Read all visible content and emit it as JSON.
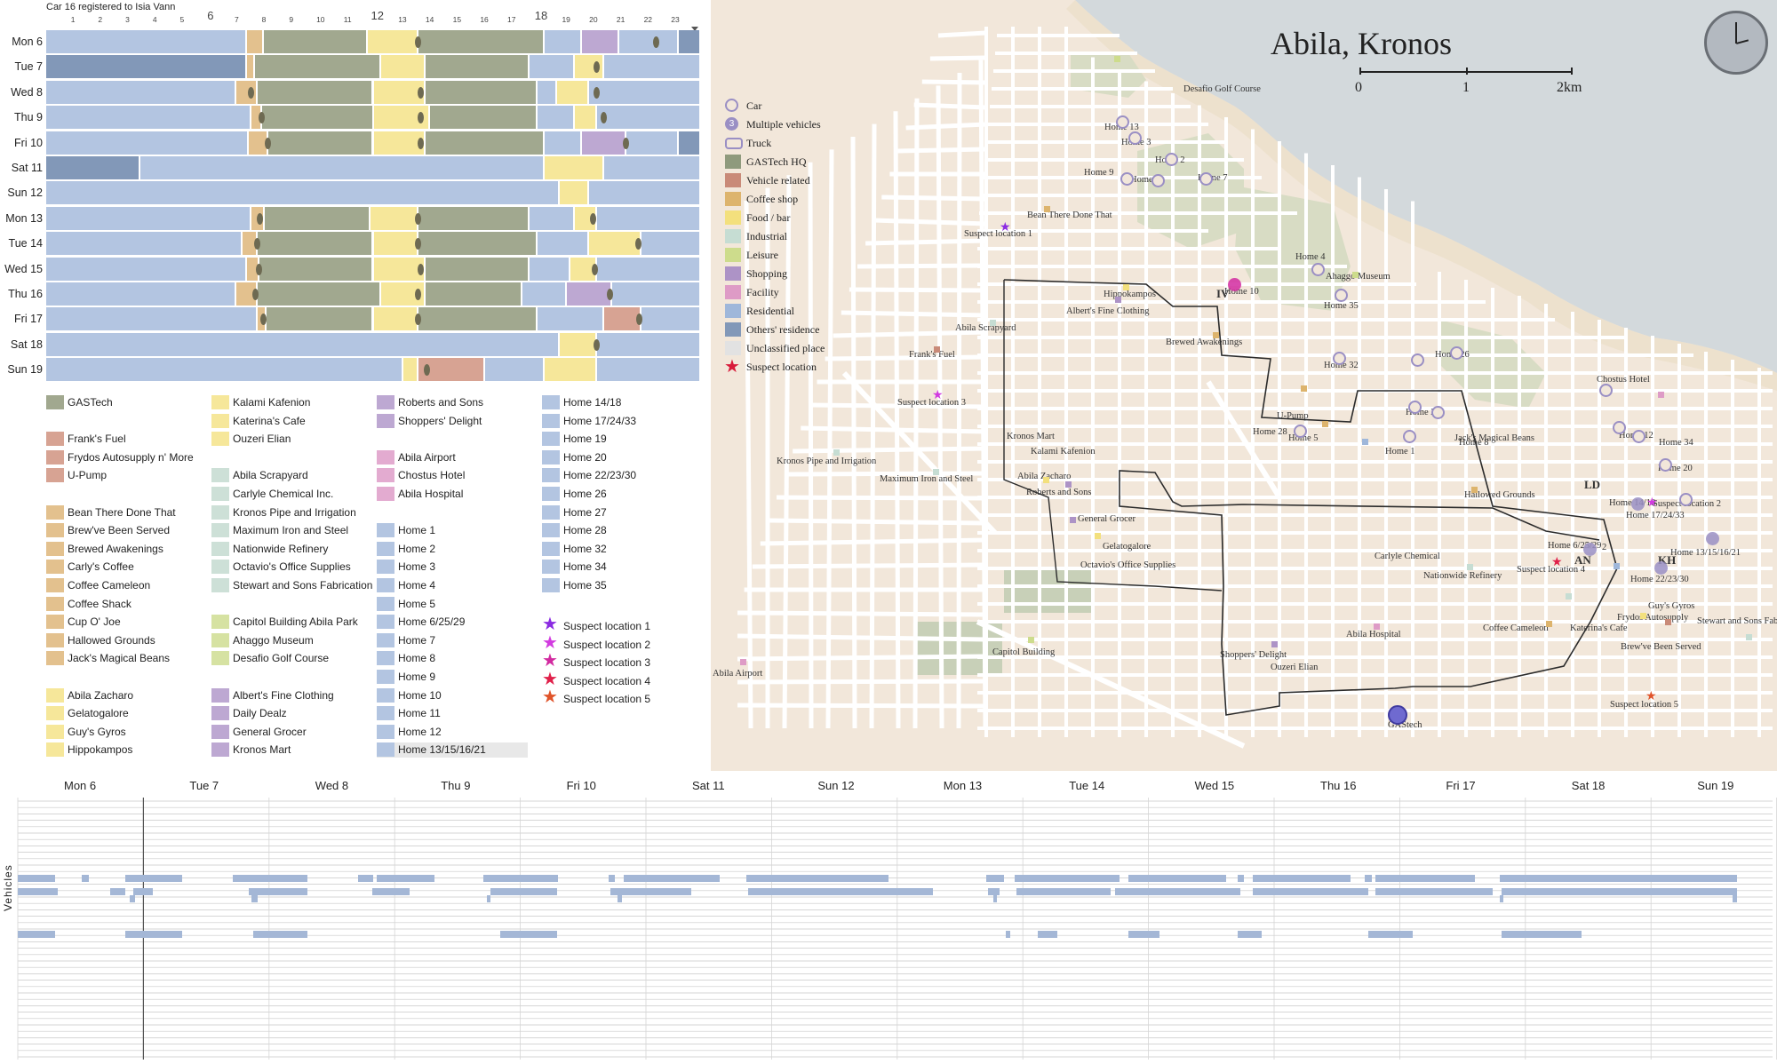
{
  "timeline": {
    "title": "Car 16 registered to Isia Vann",
    "hours": [
      "1",
      "2",
      "3",
      "4",
      "5",
      "6",
      "7",
      "8",
      "9",
      "10",
      "11",
      "12",
      "13",
      "14",
      "15",
      "16",
      "17",
      "18",
      "19",
      "20",
      "21",
      "22",
      "23"
    ],
    "days": [
      "Mon 6",
      "Tue 7",
      "Wed 8",
      "Thu 9",
      "Fri 10",
      "Sat 11",
      "Sun 12",
      "Mon 13",
      "Tue 14",
      "Wed 15",
      "Thu 16",
      "Fri 17",
      "Sat 18",
      "Sun 19"
    ]
  },
  "legend": {
    "col1": [
      {
        "label": "GASTech",
        "color": "#a1a88f"
      },
      {
        "label": "Frank's Fuel",
        "color": "#d7a393"
      },
      {
        "label": "Frydos Autosupply n' More",
        "color": "#d7a393"
      },
      {
        "label": "U-Pump",
        "color": "#d7a393"
      },
      {
        "label": "Bean There Done That",
        "color": "#e3c18e"
      },
      {
        "label": "Brew've Been Served",
        "color": "#e3c18e"
      },
      {
        "label": "Brewed Awakenings",
        "color": "#e3c18e"
      },
      {
        "label": "Carly's Coffee",
        "color": "#e3c18e"
      },
      {
        "label": "Coffee Cameleon",
        "color": "#e3c18e"
      },
      {
        "label": "Coffee Shack",
        "color": "#e3c18e"
      },
      {
        "label": "Cup O' Joe",
        "color": "#e3c18e"
      },
      {
        "label": "Hallowed Grounds",
        "color": "#e3c18e"
      },
      {
        "label": "Jack's Magical Beans",
        "color": "#e3c18e"
      },
      {
        "label": "Abila Zacharo",
        "color": "#f6e79a"
      },
      {
        "label": "Gelatogalore",
        "color": "#f6e79a"
      },
      {
        "label": "Guy's Gyros",
        "color": "#f6e79a"
      },
      {
        "label": "Hippokampos",
        "color": "#f6e79a"
      }
    ],
    "col2": [
      {
        "label": "Kalami Kafenion",
        "color": "#f6e79a"
      },
      {
        "label": "Katerina's Cafe",
        "color": "#f6e79a"
      },
      {
        "label": "Ouzeri Elian",
        "color": "#f6e79a"
      },
      {
        "label": "Abila Scrapyard",
        "color": "#cde0d7"
      },
      {
        "label": "Carlyle Chemical Inc.",
        "color": "#cde0d7"
      },
      {
        "label": "Kronos Pipe and Irrigation",
        "color": "#cde0d7"
      },
      {
        "label": "Maximum Iron and Steel",
        "color": "#cde0d7"
      },
      {
        "label": "Nationwide Refinery",
        "color": "#cde0d7"
      },
      {
        "label": "Octavio's Office Supplies",
        "color": "#cde0d7"
      },
      {
        "label": "Stewart and Sons Fabrication",
        "color": "#cde0d7"
      },
      {
        "label": "Capitol Building Abila Park",
        "color": "#d6e2a2"
      },
      {
        "label": "Ahaggo Museum",
        "color": "#d6e2a2"
      },
      {
        "label": "Desafio Golf Course",
        "color": "#d6e2a2"
      },
      {
        "label": "Albert's Fine Clothing",
        "color": "#bda8d2"
      },
      {
        "label": "Daily Dealz",
        "color": "#bda8d2"
      },
      {
        "label": "General Grocer",
        "color": "#bda8d2"
      },
      {
        "label": "Kronos Mart",
        "color": "#bda8d2"
      }
    ],
    "col3": [
      {
        "label": "Roberts and Sons",
        "color": "#bda8d2"
      },
      {
        "label": "Shoppers' Delight",
        "color": "#bda8d2"
      },
      {
        "label": "Abila Airport",
        "color": "#e3abd0"
      },
      {
        "label": "Chostus Hotel",
        "color": "#e3abd0"
      },
      {
        "label": "Abila Hospital",
        "color": "#e3abd0"
      },
      {
        "label": "Home 1",
        "color": "#b3c5e1"
      },
      {
        "label": "Home 2",
        "color": "#b3c5e1"
      },
      {
        "label": "Home 3",
        "color": "#b3c5e1"
      },
      {
        "label": "Home 4",
        "color": "#b3c5e1"
      },
      {
        "label": "Home 5",
        "color": "#b3c5e1"
      },
      {
        "label": "Home 6/25/29",
        "color": "#b3c5e1"
      },
      {
        "label": "Home 7",
        "color": "#b3c5e1"
      },
      {
        "label": "Home 8",
        "color": "#b3c5e1"
      },
      {
        "label": "Home 9",
        "color": "#b3c5e1"
      },
      {
        "label": "Home 10",
        "color": "#b3c5e1"
      },
      {
        "label": "Home 11",
        "color": "#b3c5e1"
      },
      {
        "label": "Home 12",
        "color": "#b3c5e1"
      },
      {
        "label": "Home 13/15/16/21",
        "color": "#b3c5e1"
      }
    ],
    "col4": [
      {
        "label": "Home 14/18",
        "color": "#b3c5e1"
      },
      {
        "label": "Home 17/24/33",
        "color": "#b3c5e1"
      },
      {
        "label": "Home 19",
        "color": "#b3c5e1"
      },
      {
        "label": "Home 20",
        "color": "#b3c5e1"
      },
      {
        "label": "Home 22/23/30",
        "color": "#b3c5e1"
      },
      {
        "label": "Home 26",
        "color": "#b3c5e1"
      },
      {
        "label": "Home 27",
        "color": "#b3c5e1"
      },
      {
        "label": "Home 28",
        "color": "#b3c5e1"
      },
      {
        "label": "Home 32",
        "color": "#b3c5e1"
      },
      {
        "label": "Home 34",
        "color": "#b3c5e1"
      },
      {
        "label": "Home 35",
        "color": "#b3c5e1"
      }
    ],
    "suspects": [
      {
        "label": "Suspect location 1",
        "color": "#8b2be2"
      },
      {
        "label": "Suspect location 2",
        "color": "#d23be0"
      },
      {
        "label": "Suspect location 3",
        "color": "#d22aa0"
      },
      {
        "label": "Suspect location 4",
        "color": "#e0204a"
      },
      {
        "label": "Suspect location 5",
        "color": "#e0542a"
      }
    ]
  },
  "map": {
    "title": "Abila, Kronos",
    "scale": [
      "0",
      "1",
      "2km"
    ],
    "legend": [
      {
        "label": "Car",
        "color": "#9a8fc4",
        "kind": "ring"
      },
      {
        "label": "Multiple vehicles",
        "color": "#9a8fc4",
        "kind": "num"
      },
      {
        "label": "Truck",
        "color": "#9a8fc4",
        "kind": "truck"
      },
      {
        "label": "GASTech HQ",
        "color": "#8f9a7d",
        "kind": "box"
      },
      {
        "label": "Vehicle related",
        "color": "#c98a78",
        "kind": "box"
      },
      {
        "label": "Coffee shop",
        "color": "#ddb46d",
        "kind": "box"
      },
      {
        "label": "Food / bar",
        "color": "#f3e07d",
        "kind": "box"
      },
      {
        "label": "Industrial",
        "color": "#c6ddd3",
        "kind": "box"
      },
      {
        "label": "Leisure",
        "color": "#cddc8c",
        "kind": "box"
      },
      {
        "label": "Shopping",
        "color": "#ad93c6",
        "kind": "box"
      },
      {
        "label": "Facility",
        "color": "#de9bc6",
        "kind": "box"
      },
      {
        "label": "Residential",
        "color": "#9fb7da",
        "kind": "box"
      },
      {
        "label": "Others' residence",
        "color": "#8298b8",
        "kind": "box"
      },
      {
        "label": "Unclassified place",
        "color": "#e2e2e2",
        "kind": "box"
      },
      {
        "label": "Suspect location",
        "color": "#d81b3a",
        "kind": "star"
      }
    ],
    "labels": [
      "Desafio Golf Course",
      "Home 13",
      "Home 3",
      "Home 2",
      "Home 9",
      "Home 11",
      "Home 7",
      "Bean There Done That",
      "Suspect location 1",
      "Home 4",
      "Ahaggo Museum",
      "Home 10",
      "Hippokampos",
      "Albert's Fine Clothing",
      "Home 35",
      "Abila Scrapyard",
      "Brewed Awakenings",
      "Frank's Fuel",
      "Home 32",
      "Home 26",
      "Suspect location 3",
      "Chostus Hotel",
      "U-Pump",
      "Home 28",
      "Home 27",
      "Jack's Magical Beans",
      "Home 5",
      "Home 8",
      "Home 12",
      "Home 34",
      "Kronos Mart",
      "Kalami Kafenion",
      "Home 1",
      "Kronos Pipe and Irrigation",
      "Home 20",
      "Maximum Iron and Steel",
      "Abila Zacharo",
      "Roberts and Sons",
      "Hallowed Grounds",
      "LD",
      "Home 14/18",
      "Suspect location 2",
      "Home 17/24/33",
      "General Grocer",
      "Home 6/25/29",
      "Home 13/15/16/21",
      "Gelatogalore",
      "Carlyle Chemical",
      "AN",
      "KH",
      "Octavio's Office Supplies",
      "Suspect location 4",
      "Nationwide Refinery",
      "Home 22/23/30",
      "Guy's Gyros",
      "Frydos Autosupply",
      "Stewart and Sons Fabrication",
      "Katerina's Cafe",
      "Coffee Cameleon",
      "Abila Hospital",
      "Capitol Building",
      "Shoppers' Delight",
      "Brew've Been Served",
      "Ouzeri Elian",
      "Abila Airport",
      "Suspect location 5",
      "GAStech",
      "IV",
      "2",
      "3"
    ]
  },
  "bottom": {
    "days": [
      "Mon 6",
      "Tue 7",
      "Wed 8",
      "Thu 9",
      "Fri 10",
      "Sat 11",
      "Sun 12",
      "Mon 13",
      "Tue 14",
      "Wed 15",
      "Thu 16",
      "Fri 17",
      "Sat 18",
      "Sun 19"
    ],
    "axis_label": "Vehicles"
  }
}
